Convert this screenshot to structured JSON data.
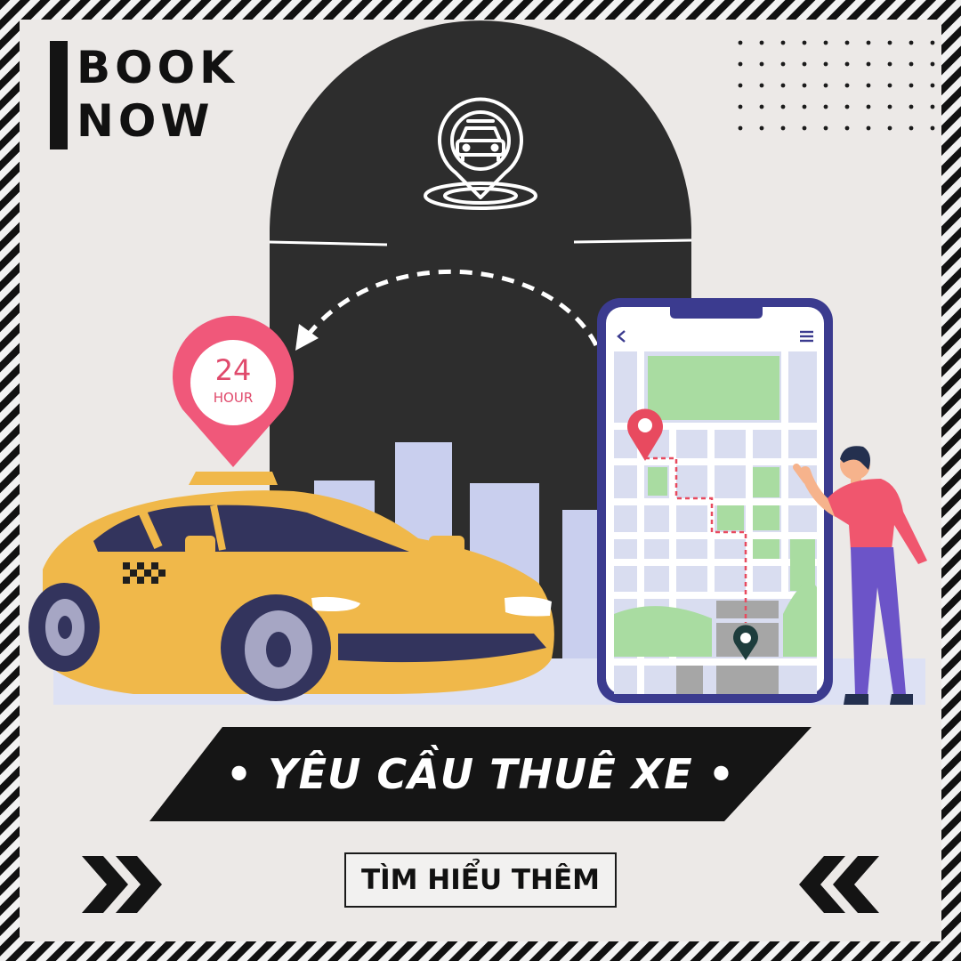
{
  "promo": {
    "tagline_line1": "BOOK",
    "tagline_line2": "NOW",
    "headline": "• YÊU CẦU THUÊ XE •",
    "cta_label": "TÌM HIỂU THÊM",
    "pin_number": "24",
    "pin_unit": "HOUR"
  },
  "icons": {
    "top": "taxi-location-pin-icon",
    "left_arrows": "double-chevron-right-icon",
    "right_arrows": "double-chevron-left-icon",
    "phone_back": "chevron-left-icon",
    "phone_menu": "hamburger-menu-icon"
  },
  "colors": {
    "background": "#ece9e7",
    "arch": "#2d2d2d",
    "taxi": "#f0b84a",
    "pin": "#f0587a",
    "map_green": "#a9dca1",
    "phone_frame": "#3b3b8f",
    "buildings": "#c9cfee",
    "person_shirt": "#f0566e",
    "person_pants": "#6c54c8"
  }
}
